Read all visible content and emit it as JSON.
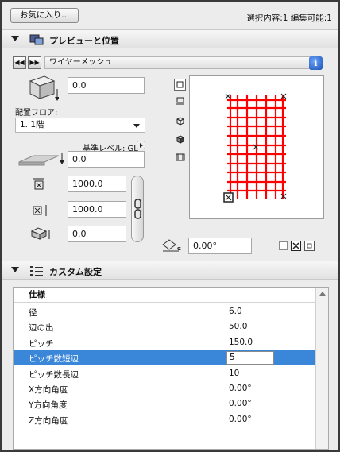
{
  "top": {
    "favorites_label": "お気に入り...",
    "selection_info": "選択内容:1 編集可能:1"
  },
  "preview_section": {
    "title": "プレビューと位置",
    "nav_prev": "◀◀",
    "nav_next": "▶▶",
    "object_name": "ワイヤーメッシュ",
    "info_label": "i",
    "offset_value": "0.0",
    "floor_label": "配置フロア:",
    "floor_value": "1. 1階",
    "ref_level_label": "基準レベル: GL",
    "elevation_value": "0.0",
    "width_value": "1000.0",
    "depth_value": "1000.0",
    "height_value": "0.0",
    "angle_value": "0.00°"
  },
  "custom_section": {
    "title": "カスタム設定",
    "table_header": "仕様",
    "rows": [
      {
        "key": "径",
        "value": "6.0"
      },
      {
        "key": "辺の出",
        "value": "50.0"
      },
      {
        "key": "ピッチ",
        "value": "150.0"
      },
      {
        "key": "ピッチ数短辺",
        "value": "5"
      },
      {
        "key": "ピッチ数長辺",
        "value": "10"
      },
      {
        "key": "X方向角度",
        "value": "0.00°"
      },
      {
        "key": "Y方向角度",
        "value": "0.00°"
      },
      {
        "key": "Z方向角度",
        "value": "0.00°"
      }
    ],
    "selected_row_index": 3
  },
  "colors": {
    "selection": "#3a86d8",
    "mesh": "#ff0000"
  }
}
